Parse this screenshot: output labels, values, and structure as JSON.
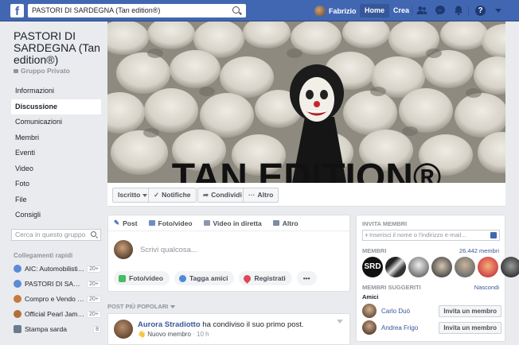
{
  "topbar": {
    "logo": "f",
    "search_value": "PASTORI DI SARDEGNA (Tan edition®)",
    "user_name": "Fabrizio",
    "home_label": "Home",
    "create_label": "Crea",
    "help_glyph": "?"
  },
  "group": {
    "title": "PASTORI DI SARDEGNA (Tan edition®)",
    "privacy": "Gruppo Privato",
    "nav": [
      "Informazioni",
      "Discussione",
      "Comunicazioni",
      "Membri",
      "Eventi",
      "Video",
      "Foto",
      "File",
      "Consigli"
    ],
    "active_nav": "Discussione",
    "search_placeholder": "Cerca in questo gruppo",
    "shortcuts_header": "Collegamenti rapidi",
    "shortcuts": [
      {
        "label": "AIC: Automobilisti I...",
        "badge": "20+",
        "color": "#5b8bd6"
      },
      {
        "label": "PASTORI DI SARDEGN...",
        "badge": "20+",
        "color": "#5b8bd6"
      },
      {
        "label": "Compro e Vendo C...",
        "badge": "20+",
        "color": "#c9773c"
      },
      {
        "label": "Official Pearl Jam T...",
        "badge": "20+",
        "color": "#b0703a"
      },
      {
        "label": "Stampa sarda",
        "badge": "8",
        "color": "#6b7b8c"
      }
    ]
  },
  "cover": {
    "banner_text": "TAN EDITION®"
  },
  "actions": {
    "joined": "Iscritto",
    "notifications": "Notifiche",
    "share": "Condividi",
    "more": "Altro"
  },
  "composer": {
    "tabs": [
      "Post",
      "Foto/video",
      "Video in diretta",
      "Altro"
    ],
    "placeholder": "Scrivi qualcosa...",
    "buttons": [
      "Foto/video",
      "Tagga amici",
      "Registrati"
    ],
    "more": "•••"
  },
  "feed": {
    "section_label": "POST PIÙ POPOLARI",
    "post": {
      "author": "Aurora Stradiotto",
      "text": " ha condiviso il suo primo post.",
      "badge": "Nuovo membro",
      "time": "· 10 h"
    }
  },
  "right": {
    "invite_header": "INVITA MEMBRI",
    "invite_placeholder": "Inserisci il nome o l'indirizzo e-mail...",
    "members_header": "MEMBRI",
    "members_count": "26.442 membri",
    "member_logo": "SRD",
    "suggested_header": "MEMBRI SUGGERITI",
    "hide_label": "Nascondi",
    "friends_label": "Amici",
    "suggestions": [
      {
        "name": "Carlo Duò",
        "button": "Invita un membro"
      },
      {
        "name": "Andrea Frigo",
        "button": "Invita un membro"
      }
    ]
  },
  "colors": {
    "brand": "#4267b2",
    "link": "#365899",
    "background": "#e9ebee"
  }
}
